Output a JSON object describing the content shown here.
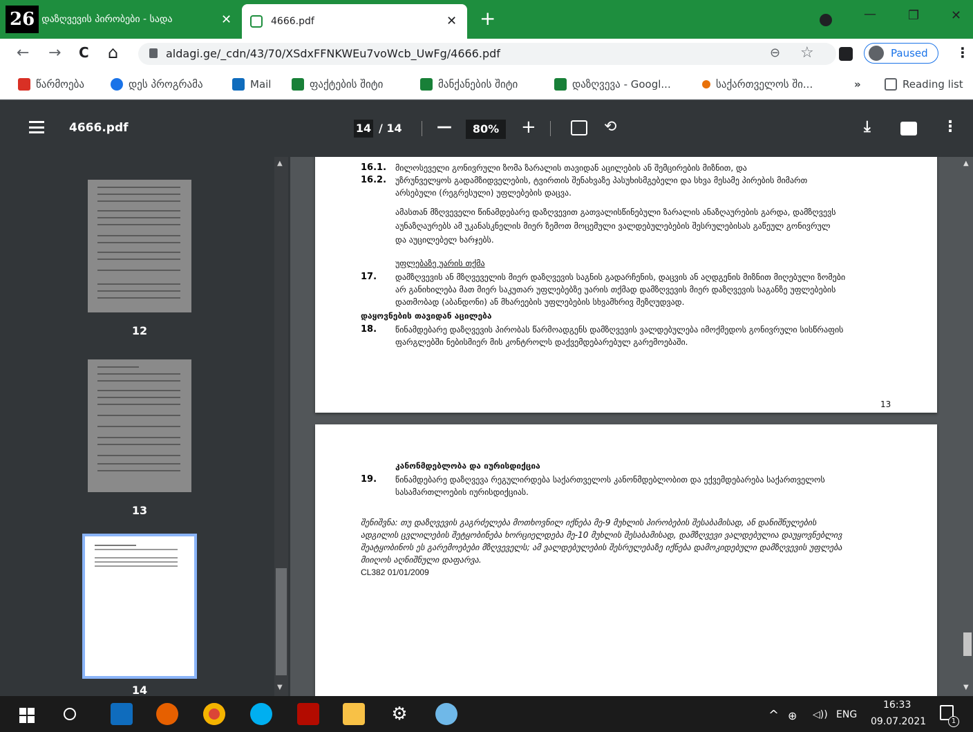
{
  "tabs": [
    {
      "badge": "26",
      "label": "დაზღვევის პირობები - სადა",
      "close": "✕"
    },
    {
      "label": "4666.pdf",
      "close": "✕"
    }
  ],
  "new_tab": "+",
  "window": {
    "minimize": "—",
    "restore": "❐",
    "close": "✕"
  },
  "nav": {
    "back": "←",
    "forward": "→",
    "reload": "C",
    "home": "⌂"
  },
  "address": {
    "url": "aldagi.ge/_cdn/43/70/XSdxFFNKWEu7voWcb_UwFg/4666.pdf",
    "zoom_icon": "⊖",
    "star": "☆"
  },
  "profile": {
    "label": "Paused"
  },
  "bookmarks": [
    {
      "label": "წარმოება",
      "color": "#d93025"
    },
    {
      "label": "დეს პროგრამა",
      "color": "#1a73e8"
    },
    {
      "label": "Mail",
      "color": "#0f6cbd"
    },
    {
      "label": "ფაქტების შიტი",
      "color": "#188038"
    },
    {
      "label": "მანქანების შიტი",
      "color": "#188038"
    },
    {
      "label": "დაზღვევა - Googl...",
      "color": "#188038"
    },
    {
      "label": "საქართველოს ში...",
      "color": "#e8710a"
    }
  ],
  "bookmarks_more": "»",
  "reading_list": "Reading list",
  "pdf": {
    "title": "4666.pdf",
    "page_current": "14",
    "page_total": "/ 14",
    "zoom": "80%",
    "minus": "—",
    "plus": "+"
  },
  "thumbs": [
    {
      "label": "12"
    },
    {
      "label": "13"
    },
    {
      "label": "14"
    }
  ],
  "page13": {
    "lines": [
      {
        "num": "16.1.",
        "text": "მილოსეველი გონივრული ზომა ზარალის თავიდან აცილების ან შემცირების მიზნით, და"
      },
      {
        "num": "16.2.",
        "text": "უზრუნველყოს გადამზიდველების, ტვირთის შენახვაზე პასუხისმგებელი და სხვა მესამე პირების მიმართ"
      },
      {
        "num": "",
        "text": "არსებული (რეგრესული) უფლებების დაცვა."
      }
    ],
    "para1": [
      "ამასთან მზღვეველი წინამდებარე დაზღვევით გათვალისწინებული ზარალის ანაზღაურების გარდა, დამზღვევს",
      "აუნაზღაურებს ამ უკანასკნელის მიერ ზემოთ მოცემული ვალდებულებების შესრულებისას გაწეულ გონივრულ",
      "და აუცილებელ ხარჯებს."
    ],
    "heading17": "უფლებაზე უარის თქმა",
    "num17": "17.",
    "text17": [
      "დამზღვევის ან მზღვეველის მიერ დაზღვევის საგნის გადარჩენის, დაცვის ან აღდგენის მიზნით მიღებული ზომები",
      "არ განიხილება მათ მიერ საკუთარ უფლებებზე უარის თქმად დამზღვევის მიერ დაზღვევის საგანზე უფლებების",
      "დათმობად (აბანდონი) ან მხარეების უფლებების სხვამხრივ შეზღუდვად."
    ],
    "heading18": "დაყოვნების თავიდან აცილება",
    "num18": "18.",
    "text18": [
      "წინამდებარე დაზღვევის პირობას წარმოადგენს დამზღვევის ვალდებულება იმოქმედოს გონივრული სისწრაფის",
      "ფარგლებში ნებისმიერ მის კონტროლს დაქვემდებარებულ გარემოებაში."
    ],
    "page_no": "13"
  },
  "page14": {
    "heading19": "კანონმდებლობა და იურისდიქცია",
    "num19": "19.",
    "text19": [
      "წინამდებარე დაზღვევა რეგულირდება საქართველოს  კანონმდებლობით და ექვემდებარება საქართველოს",
      "სასამართლოების იურისდიქციას."
    ],
    "note": [
      "შენიშვნა: თუ დაზღვევის გაგრძელება მოთხოვნილ იქნება მე-9 მუხლის პირობების შესაბამისად, ან დანიშნულების",
      "ადგილის ცვლილების შეტყობინება ხორციელდება მე-10 მუხლის შესაბამისად, დამზღვევი ვალდებულია დაუყოვნებლივ",
      "შეატყობინოს ეს გარემოებები მზღვეველს; ამ ვალდებულების შესრულებაზე იქნება დამოკიდებული დამზღვევის უფლება",
      "მიიღოს აღნიშნული დაფარვა."
    ],
    "code": "CL382  01/01/2009"
  },
  "taskbar": {
    "lang": "ENG",
    "time": "16:33",
    "date": "09.07.2021",
    "up_arrow": "^",
    "notif": "1"
  }
}
